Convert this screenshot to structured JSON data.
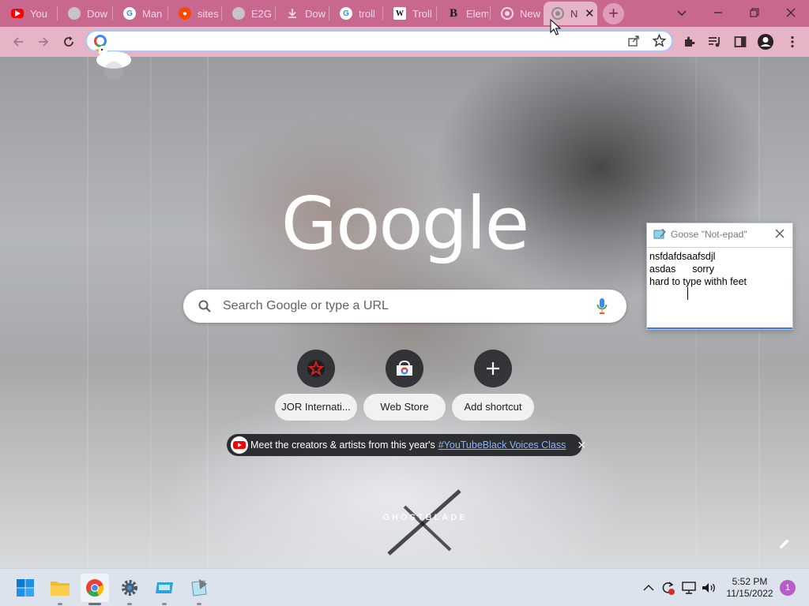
{
  "browser": {
    "tabs": [
      {
        "label": "You",
        "icon": "youtube-icon",
        "color": "#ff0000"
      },
      {
        "label": "Dow",
        "icon": "globe-icon",
        "color": "#9aa0a6"
      },
      {
        "label": "Man",
        "icon": "google-icon",
        "color": "#4285f4"
      },
      {
        "label": "sites",
        "icon": "reddit-icon",
        "color": "#ff4500"
      },
      {
        "label": "E2G",
        "icon": "globe-icon",
        "color": "#9aa0a6"
      },
      {
        "label": "Dow",
        "icon": "download-icon",
        "color": "#5f6368"
      },
      {
        "label": "troll",
        "icon": "google-icon",
        "color": "#4285f4"
      },
      {
        "label": "Troll",
        "icon": "wikipedia-icon",
        "color": "#ffffff"
      },
      {
        "label": "Elem",
        "icon": "site-b-icon",
        "color": "#000000"
      },
      {
        "label": "New",
        "icon": "chrome-icon",
        "color": "#5f6368"
      },
      {
        "label": "N",
        "icon": "chrome-icon",
        "color": "#5f6368",
        "active": true
      }
    ],
    "new_tab_symbol": "+",
    "omnibox": {
      "value": "",
      "placeholder": ""
    },
    "colors": {
      "frame": "#c8688f",
      "toolbar": "#e6b3c7",
      "active_tab": "#e6b3c7"
    }
  },
  "ntp": {
    "logo_text": "Google",
    "search_placeholder": "Search Google or type a URL",
    "shortcuts": [
      {
        "label": "JOR Internati...",
        "icon": "star-icon"
      },
      {
        "label": "Web Store",
        "icon": "webstore-icon"
      },
      {
        "label": "Add shortcut",
        "icon": "plus-icon"
      }
    ],
    "promo": {
      "text": "Meet the creators & artists from this year's",
      "link": "#YouTubeBlack Voices Class"
    },
    "brand_text": "GHOSTBLADE"
  },
  "notepad": {
    "title": "Goose \"Not-epad\"",
    "lines": [
      "nsfdafdsaafsdjl",
      "asdas      sorry",
      "hard to type withh feet"
    ]
  },
  "taskbar": {
    "apps": [
      {
        "name": "start",
        "icon": "windows-start-icon"
      },
      {
        "name": "file-explorer",
        "icon": "folder-icon"
      },
      {
        "name": "chrome",
        "icon": "chrome-icon",
        "active": true
      },
      {
        "name": "settings",
        "icon": "settings-gear-icon"
      },
      {
        "name": "app-5",
        "icon": "app-window-icon"
      },
      {
        "name": "notepad",
        "icon": "notepad-icon"
      }
    ],
    "clock_time": "5:52 PM",
    "clock_date": "11/15/2022",
    "notification_count": "1"
  }
}
